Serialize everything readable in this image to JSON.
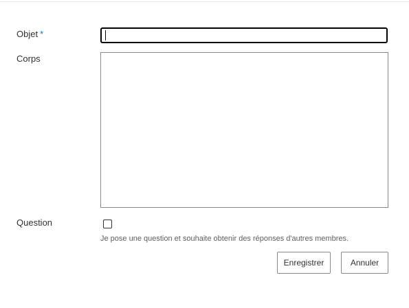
{
  "form": {
    "subject": {
      "label": "Objet",
      "required_marker": "*",
      "value": ""
    },
    "body": {
      "label": "Corps",
      "value": ""
    },
    "question": {
      "label": "Question",
      "checked": false,
      "hint": "Je pose une question et souhaite obtenir des réponses d'autres membres."
    }
  },
  "actions": {
    "save_label": "Enregistrer",
    "cancel_label": "Annuler"
  },
  "colors": {
    "required_marker": "#0078d4",
    "text": "#323130",
    "hint_text": "#605e5c",
    "border": "#8a8886"
  }
}
